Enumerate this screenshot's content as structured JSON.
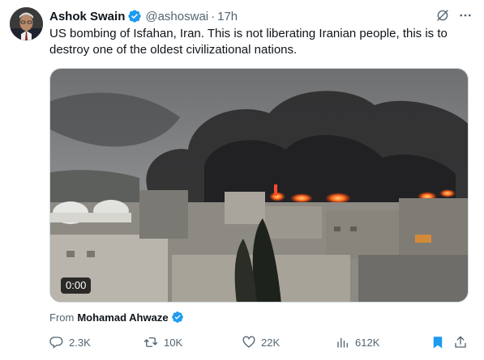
{
  "author": {
    "name": "Ashok Swain",
    "handle": "@ashoswai",
    "separator": "·",
    "time": "17h",
    "verified": true
  },
  "tweet": {
    "line1": "US bombing of Isfahan, Iran. This is not liberating Iranian people, this is to",
    "line2": "destroy one of the oldest civilizational nations."
  },
  "media": {
    "type": "video",
    "duration": "0:00",
    "description_icon": "video-thumbnail"
  },
  "source": {
    "prefix": "From",
    "name": "Mohamad Ahwaze",
    "verified": true
  },
  "actions": {
    "replies": "2.3K",
    "reposts": "10K",
    "likes": "22K",
    "views": "612K"
  },
  "colors": {
    "verified": "#1d9bf0",
    "bookmark": "#1d9bf0",
    "text_secondary": "#536471",
    "text_primary": "#0f1419"
  }
}
